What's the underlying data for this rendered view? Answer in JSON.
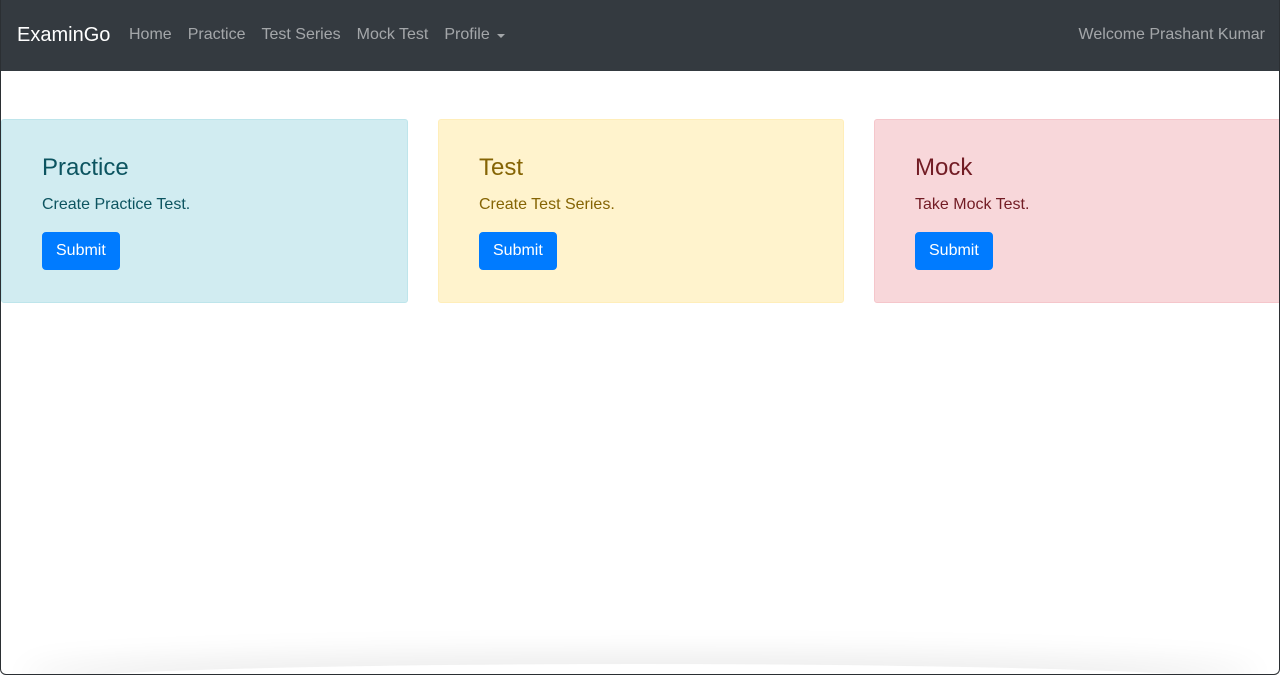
{
  "navbar": {
    "brand": "ExaminGo",
    "links": [
      "Home",
      "Practice",
      "Test Series",
      "Mock Test"
    ],
    "profile": "Profile",
    "welcome": "Welcome Prashant Kumar"
  },
  "cards": [
    {
      "title": "Practice",
      "text": "Create Practice Test.",
      "button": "Submit"
    },
    {
      "title": "Test",
      "text": "Create Test Series.",
      "button": "Submit"
    },
    {
      "title": "Mock",
      "text": "Take Mock Test.",
      "button": "Submit"
    }
  ],
  "colors": {
    "navbar_bg": "#343a40",
    "primary": "#007bff",
    "info_bg": "#d1ecf1",
    "warning_bg": "#fff3cd",
    "danger_bg": "#f8d7da"
  }
}
